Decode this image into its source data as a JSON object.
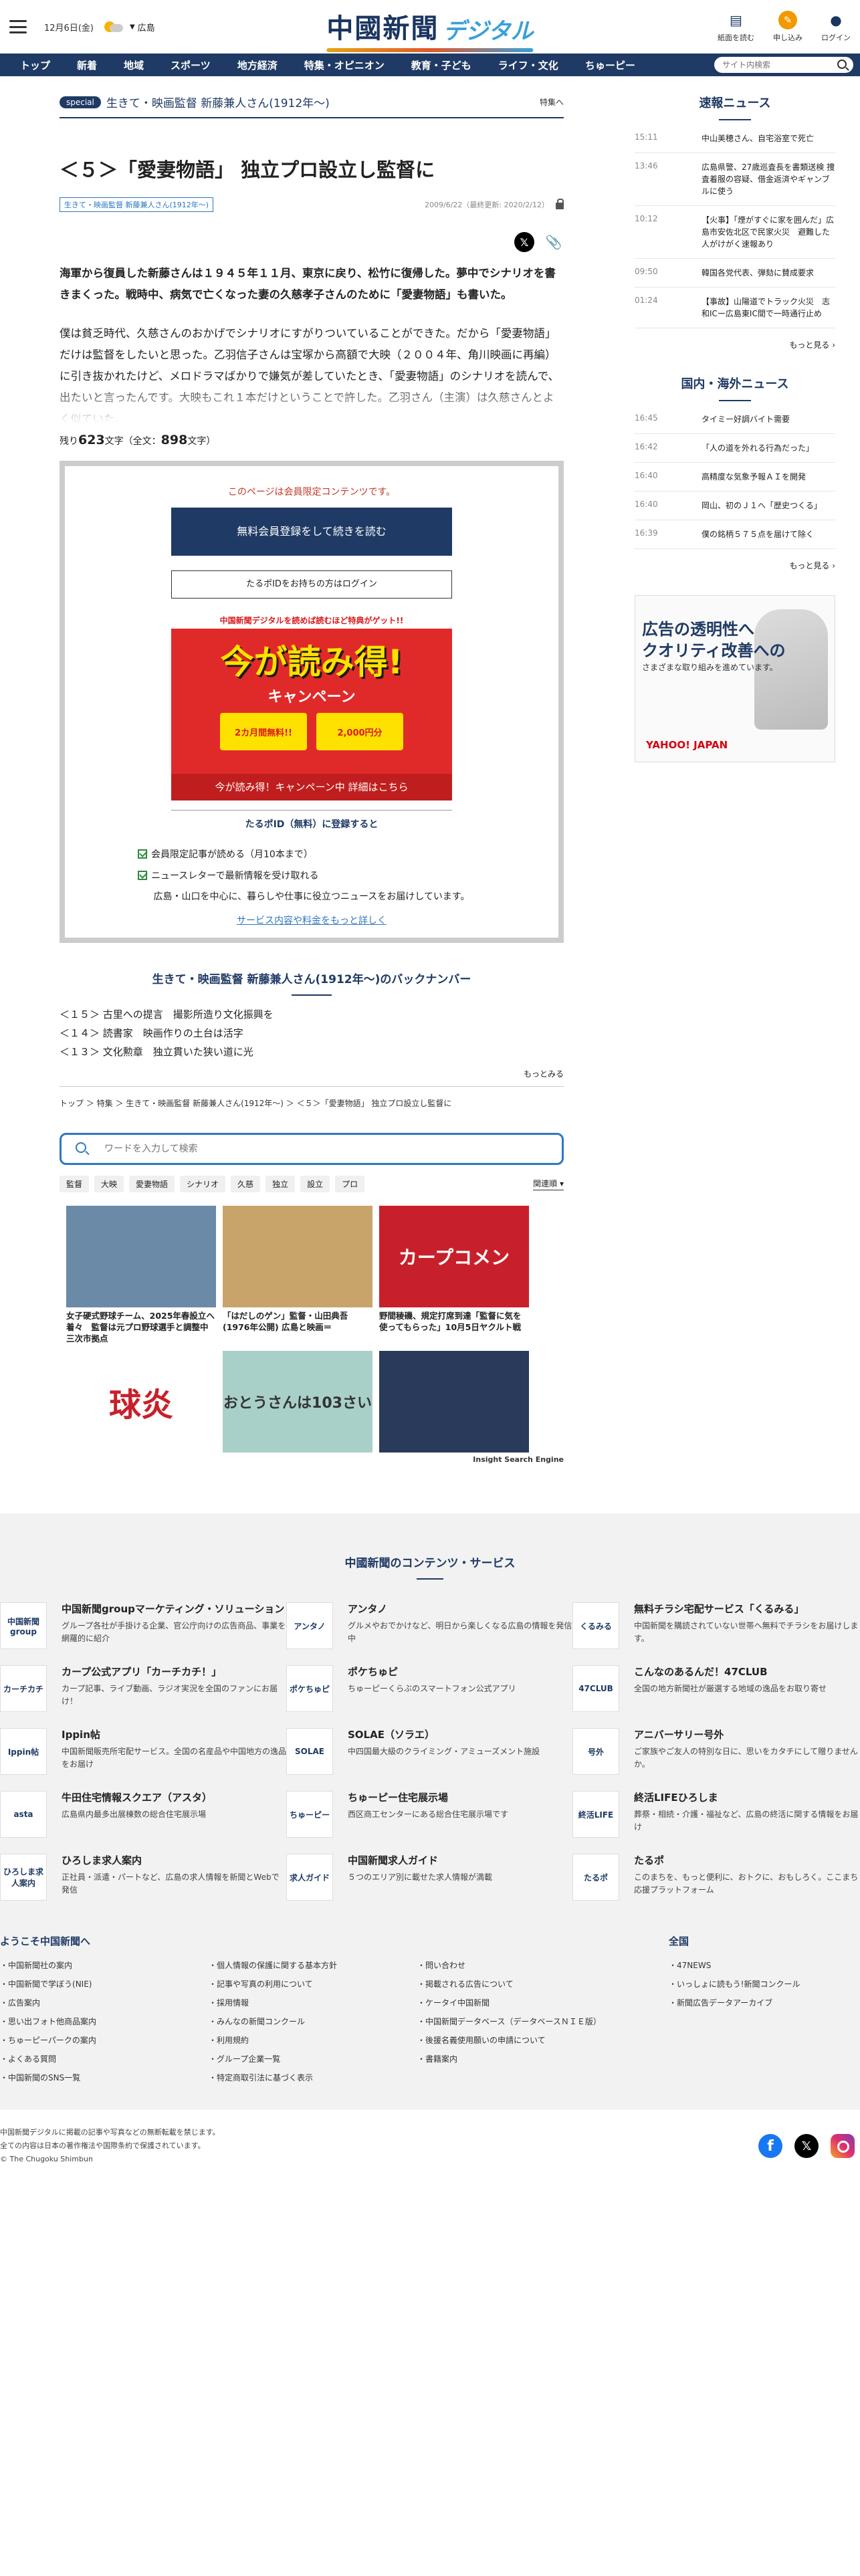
{
  "header": {
    "date": "12月6日(金)",
    "region": "広島",
    "logo_main": "中國新聞",
    "logo_sub": "デジタル",
    "buttons": [
      {
        "label": "紙面を読む",
        "icon": "newspaper-icon"
      },
      {
        "label": "申し込み",
        "icon": "signup-icon"
      },
      {
        "label": "ログイン",
        "icon": "user-icon"
      }
    ]
  },
  "nav": {
    "items": [
      "トップ",
      "新着",
      "地域",
      "スポーツ",
      "地方経済",
      "特集・オピニオン",
      "教育・子ども",
      "ライフ・文化",
      "ちゅーピー"
    ],
    "search_placeholder": "サイト内検索"
  },
  "special": {
    "tag": "special",
    "title": "生きて・映画監督 新藤兼人さん(1912年〜)",
    "link": "特集へ"
  },
  "article": {
    "title": "＜５＞「愛妻物語」 独立プロ設立し監督に",
    "series_tag": "生きて・映画監督 新藤兼人さん(1912年〜)",
    "dates": "2009/6/22（最終更新: 2020/2/12）",
    "lead": "海軍から復員した新藤さんは１９４５年１１月、東京に戻り、松竹に復帰した。夢中でシナリオを書きまくった。戦時中、病気で亡くなった妻の久慈孝子さんのために「愛妻物語」も書いた。",
    "body": "僕は貧乏時代、久慈さんのおかげでシナリオにすがりついていることができた。だから「愛妻物語」だけは監督をしたいと思った。乙羽信子さんは宝塚から高額で大映（２００４年、角川映画に再編）に引き抜かれたけど、メロドラマばかりで嫌気が差していたとき、「愛妻物語」のシナリオを読んで、出たいと言ったんです。大映もこれ１本だけということで許した。乙羽さん（主演）は久慈さんとよく似ていた。",
    "remain_prefix": "残り",
    "remain_count": "623",
    "remain_mid": "文字（全文：",
    "total_count": "898",
    "remain_suffix": "文字）"
  },
  "paywall": {
    "message": "このページは会員限定コンテンツです。",
    "register_button": "無料会員登録をして続きを読む",
    "login_button": "たるポIDをお持ちの方はログイン",
    "campaign_top": "中国新聞デジタルを読めば読むほど特典がゲット!!",
    "campaign_big": "今が読み得!",
    "campaign_sub": "キャンペーン",
    "campaign_box1": "2カ月間無料!!",
    "campaign_box2": "2,000円分",
    "campaign_footer": "今が読み得！キャンペーン中 詳細はこちら",
    "register_heading": "たるポID（無料）に登録すると",
    "benefits": [
      "会員限定記事が読める（月10本まで）",
      "ニュースレターで最新情報を受け取れる"
    ],
    "note": "広島・山口を中心に、暮らしや仕事に役立つニュースをお届けしています。",
    "more_link": "サービス内容や料金をもっと詳しく"
  },
  "backnumber": {
    "title": "生きて・映画監督 新藤兼人さん(1912年〜)のバックナンバー",
    "items": [
      "＜１５＞ 古里への提言　撮影所造り文化振興を",
      "＜１４＞ 読書家　映画作りの土台は活字",
      "＜１３＞ 文化勲章　独立貫いた狭い道に光"
    ],
    "more": "もっとみる"
  },
  "breadcrumb": "トップ ＞ 特集 ＞ 生きて・映画監督 新藤兼人さん(1912年〜) ＞ ＜５＞「愛妻物語」 独立プロ設立し監督に",
  "search": {
    "placeholder": "ワードを入力して検索",
    "keywords": [
      "監督",
      "大映",
      "愛妻物語",
      "シナリオ",
      "久慈",
      "独立",
      "設立",
      "プロ"
    ],
    "sort": "関連順"
  },
  "insight": {
    "cards": [
      {
        "caption": "女子硬式野球チーム、2025年春設立へ 着々　監督は元プロ野球選手と調整中　三次市拠点",
        "color": "#6a8aa8",
        "text": ""
      },
      {
        "caption": "「はだしのゲン」監督・山田典吾(1976年公開) 広島と映画＝",
        "color": "#c9a46a",
        "text": ""
      },
      {
        "caption": "野間稜磯、規定打席到達「監督に気を使ってもらった」10月5日ヤクルト戦",
        "color": "#c8202a",
        "text": "カープコメン"
      },
      {
        "caption": "",
        "color": "#ffffff",
        "text": "球炎"
      },
      {
        "caption": "",
        "color": "#a8d0c8",
        "text": "おとうさんは103さい"
      },
      {
        "caption": "",
        "color": "#2a3a5a",
        "text": ""
      }
    ],
    "logo": "Insight Search Engine"
  },
  "sidebar": {
    "breaking_title": "速報ニュース",
    "breaking": [
      {
        "time": "15:11",
        "headline": "中山美穂さん、自宅浴室で死亡"
      },
      {
        "time": "13:46",
        "headline": "広島県警、27歳巡査長を書類送検 捜査着服の容疑、借金返済やギャンブルに使う"
      },
      {
        "time": "10:12",
        "headline": "【火事】「煙がすぐに家を囲んだ」広島市安佐北区で民家火災　避難した人がけがく速報あり"
      },
      {
        "time": "09:50",
        "headline": "韓国各党代表、弾劾に賛成要求"
      },
      {
        "time": "01:24",
        "headline": "【事故】山陽道でトラック火災　志和ICー広島東IC間で一時通行止め"
      }
    ],
    "breaking_more": "もっと見る",
    "national_title": "国内・海外ニュース",
    "national": [
      {
        "time": "16:45",
        "headline": "タイミー好調バイト需要"
      },
      {
        "time": "16:42",
        "headline": "「人の道を外れる行為だった」"
      },
      {
        "time": "16:40",
        "headline": "高精度な気象予報ＡＩを開発"
      },
      {
        "time": "16:40",
        "headline": "岡山、初のＪ１へ「歴史つくる」"
      },
      {
        "time": "16:39",
        "headline": "僕の銘柄５７５点を届けて除く"
      }
    ],
    "national_more": "もっと見る",
    "ad_text1": "広告の透明性へ\nクオリティ改善への",
    "ad_text2": "さまざまな取り組みを進めています。",
    "ad_logo": "YAHOO! JAPAN"
  },
  "footer": {
    "contents_title": "中國新聞のコンテンツ・サービス",
    "services": [
      {
        "name": "中国新聞groupマーケティング・ソリューション",
        "desc": "グループ各社が手掛ける企業、官公庁向けの広告商品、事業を網羅的に紹介",
        "logo": "中国新聞group"
      },
      {
        "name": "アンタノ",
        "desc": "グルメやおでかけなど、明日から楽しくなる広島の情報を発信中",
        "logo": "アンタノ"
      },
      {
        "name": "無料チラシ宅配サービス「くるみる」",
        "desc": "中国新聞を購読されていない世帯へ無料でチラシをお届けします。",
        "logo": "くるみる"
      },
      {
        "name": "カープ公式アプリ「カーチカチ！」",
        "desc": "カープ記事、ライブ動画、ラジオ実況を全国のファンにお届け！",
        "logo": "カーチカチ"
      },
      {
        "name": "ポケちゅピ",
        "desc": "ちゅーピーくらぶのスマートフォン公式アプリ",
        "logo": "ポケちゅピ"
      },
      {
        "name": "こんなのあるんだ！47CLUB",
        "desc": "全国の地方新聞社が厳選する地域の逸品をお取り寄せ",
        "logo": "47CLUB"
      },
      {
        "name": "Ippin帖",
        "desc": "中国新聞販売所宅配サービス。全国の名産品や中国地方の逸品をお届け",
        "logo": "Ippin帖"
      },
      {
        "name": "SOLAE（ソラエ）",
        "desc": "中四国最大級のクライミング・アミューズメント施設",
        "logo": "SOLAE"
      },
      {
        "name": "アニバーサリー号外",
        "desc": "ご家族やご友人の特別な日に、思いをカタチにして贈りませんか。",
        "logo": "号外"
      },
      {
        "name": "牛田住宅情報スクエア（アスタ）",
        "desc": "広島県内最多出展棟数の総合住宅展示場",
        "logo": "asta"
      },
      {
        "name": "ちゅーピー住宅展示場",
        "desc": "西区商工センターにある総合住宅展示場です",
        "logo": "ちゅーピー"
      },
      {
        "name": "終活LIFEひろしま",
        "desc": "葬祭・相続・介護・福祉など、広島の終活に関する情報をお届け",
        "logo": "終活LIFE"
      },
      {
        "name": "ひろしま求人案内",
        "desc": "正社員・派遣・パートなど、広島の求人情報を新聞とWebで発信",
        "logo": "ひろしま求人案内"
      },
      {
        "name": "中国新聞求人ガイド",
        "desc": "５つのエリア別に載せた求人情報が満載",
        "logo": "求人ガイド"
      },
      {
        "name": "たるポ",
        "desc": "このまちを、もっと便利に、おトクに、おもしろく。ここまち応援プラットフォーム",
        "logo": "たるポ"
      }
    ],
    "welcome_title": "ようこそ中国新聞へ",
    "welcome_col1": [
      "中国新聞社の案内",
      "中国新聞で学ぼう(NIE)",
      "広告案内",
      "思い出フォト他商品案内",
      "ちゅーピーパークの案内",
      "よくある質問",
      "中国新聞のSNS一覧"
    ],
    "welcome_col2": [
      "個人情報の保護に関する基本方針",
      "記事や写真の利用について",
      "採用情報",
      "みんなの新聞コンクール",
      "利用規約",
      "グループ企業一覧",
      "特定商取引法に基づく表示"
    ],
    "welcome_col3": [
      "問い合わせ",
      "掲載される広告について",
      "ケータイ中国新聞",
      "中国新聞データベース（データベースＮＩＥ版）",
      "後援名義使用願いの申請について",
      "書籍案内"
    ],
    "zenkoku_title": "全国",
    "zenkoku": [
      "47NEWS",
      "いっしょに読もう!新聞コンクール",
      "新聞広告データアーカイブ"
    ],
    "copy1": "中国新聞デジタルに掲載の記事や写真などの無断転載を禁じます。",
    "copy2": "全ての内容は日本の著作権法や国際条約で保護されています。",
    "copy3": "© The Chugoku Shimbun"
  },
  "colors": {
    "navy": "#1f3a64",
    "accent_blue": "#2f77c0",
    "paywall_red": "#c0392b",
    "campaign_red": "#e02a2a"
  }
}
